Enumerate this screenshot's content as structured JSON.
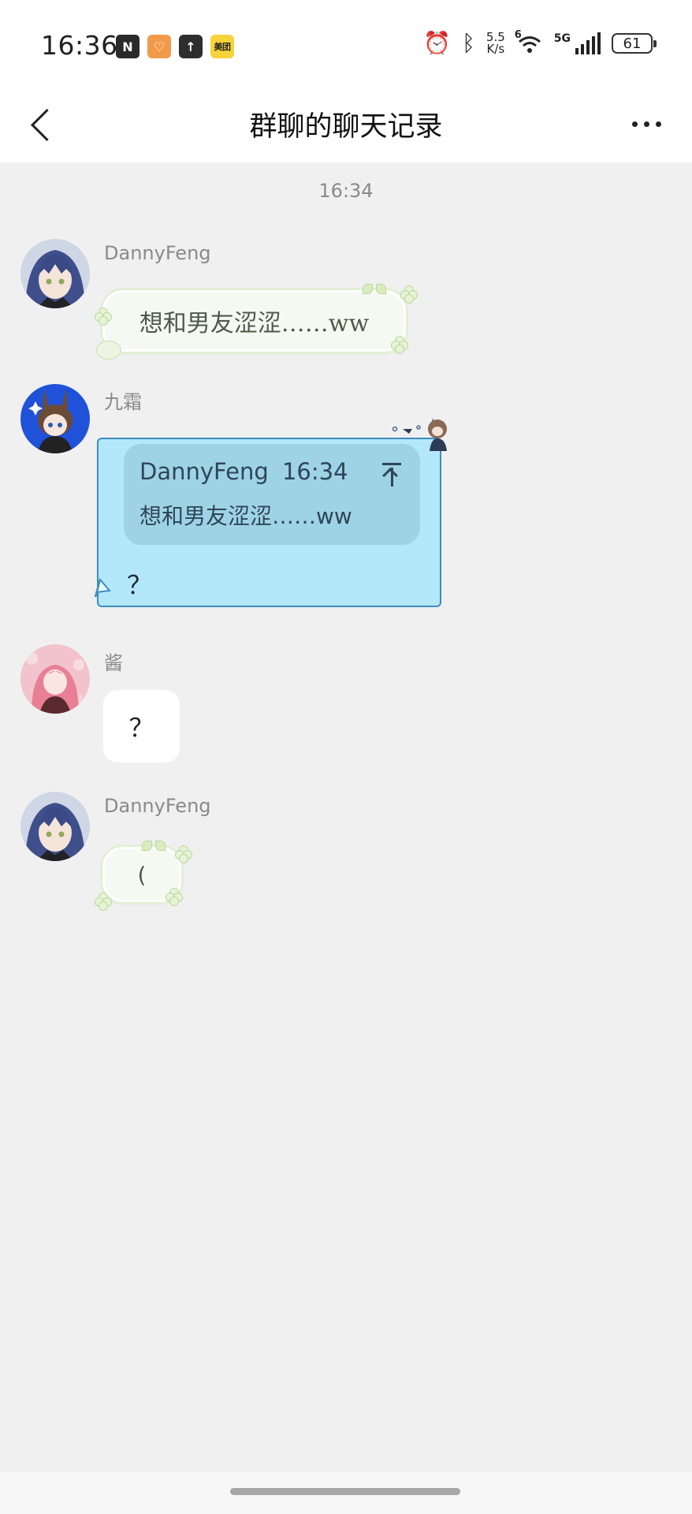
{
  "status_bar": {
    "time": "16:36",
    "app_icons": [
      {
        "name": "nfc-icon",
        "glyph": "N"
      },
      {
        "name": "heart-app-icon",
        "glyph": "♡"
      },
      {
        "name": "upload-app-icon",
        "glyph": "↑"
      },
      {
        "name": "meituan-app-icon",
        "glyph": "美团"
      }
    ],
    "alarm_glyph": "⏰",
    "bluetooth_glyph": "ᛒ",
    "net_speed_value": "5.5",
    "net_speed_unit": "K/s",
    "wifi_label": "6",
    "cellular_label": "5G",
    "battery_level": "61"
  },
  "header": {
    "title": "群聊的聊天记录"
  },
  "chat": {
    "timestamp": "16:34",
    "messages": [
      {
        "sender": "DannyFeng",
        "avatar": "anime-girl-avatar",
        "text": "想和男友涩涩……ww"
      },
      {
        "sender": "九霜",
        "avatar": "bunny-girl-avatar",
        "quote": {
          "sender": "DannyFeng",
          "time": "16:34",
          "text": "想和男友涩涩……ww"
        },
        "text": "？"
      },
      {
        "sender": "酱",
        "avatar": "pink-hair-avatar",
        "text": "？"
      },
      {
        "sender": "DannyFeng",
        "avatar": "anime-girl-avatar",
        "text": "("
      }
    ]
  },
  "colors": {
    "background": "#f0f0f0",
    "header": "#ffffff",
    "reply_bubble": "#b3e8fa",
    "reply_border": "#3d8dbe",
    "quote_card": "#9ed3e6",
    "deco_bubble": "#f6f9f2"
  }
}
